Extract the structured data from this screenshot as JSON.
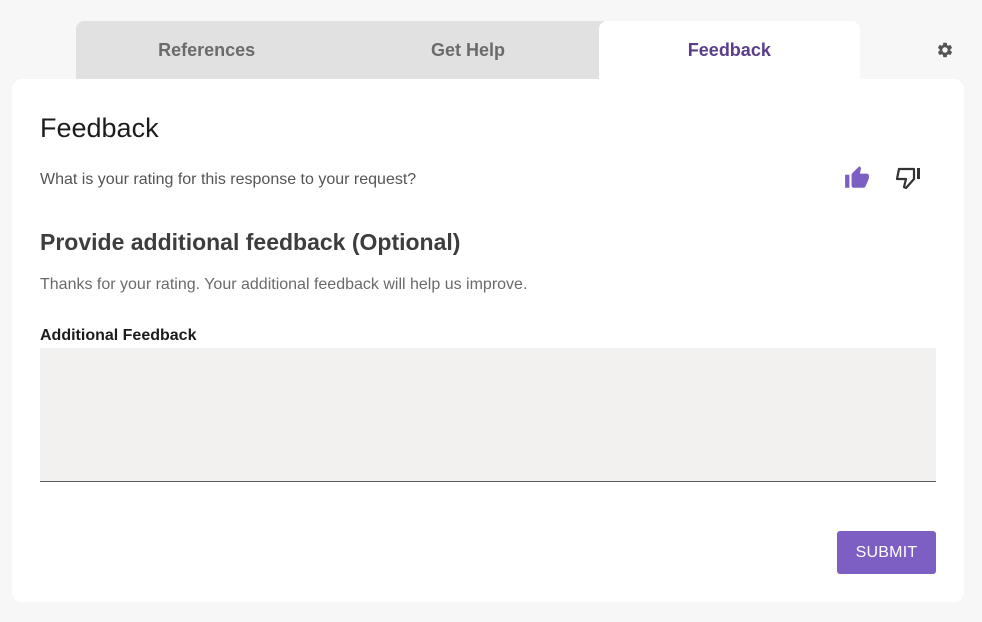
{
  "tabs": [
    {
      "label": "References"
    },
    {
      "label": "Get Help"
    },
    {
      "label": "Feedback"
    }
  ],
  "active_tab": "Feedback",
  "settings_icon": "gear-icon",
  "feedback": {
    "title": "Feedback",
    "rating_question": "What is your rating for this response to your request?",
    "rating_icons": [
      "thumbs-up-icon",
      "thumbs-down-icon"
    ],
    "selected_rating": "thumbs-up",
    "additional_title": "Provide additional feedback (Optional)",
    "thanks_text": "Thanks for your rating. Your additional feedback will help us improve.",
    "field_label": "Additional Feedback",
    "field_value": "",
    "submit_label": "SUBMIT"
  },
  "colors": {
    "accent": "#7d5fc4",
    "active_tab_text": "#5a3e8c",
    "tabbar_bg": "#e1e1e1",
    "textarea_bg": "#f2f1f0"
  }
}
